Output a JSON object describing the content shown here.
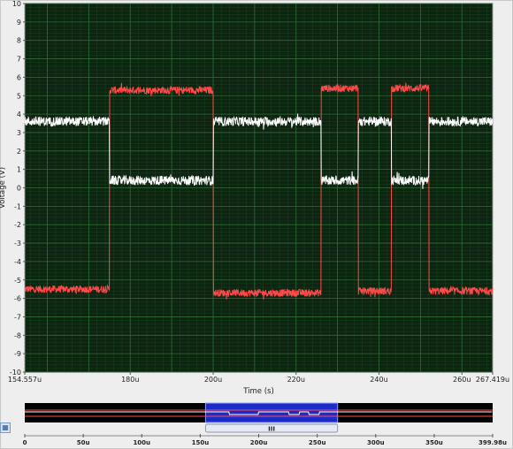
{
  "chart_data": {
    "type": "line",
    "title": "",
    "ylabel": "Voltage (V)",
    "xlabel": "Time (s)",
    "ylim": [
      -10,
      10
    ],
    "xlim": [
      154.557,
      267.419
    ],
    "x_unit": "u",
    "y_ticks": [
      10,
      9,
      8,
      7,
      6,
      5,
      4,
      3,
      2,
      1,
      0,
      -1,
      -2,
      -3,
      -4,
      -5,
      -6,
      -7,
      -8,
      -9,
      -10
    ],
    "x_tick_labels": [
      "154.557u",
      "180u",
      "200u",
      "220u",
      "240u",
      "260u",
      "267.419u"
    ],
    "x_tick_values": [
      154.557,
      180,
      200,
      220,
      240,
      260,
      267.419
    ],
    "grid": true,
    "background": "#0c2410",
    "grid_major_color": "#2f6b38",
    "grid_minor_color": "#1a4220",
    "series": [
      {
        "color": "#ff4a4a",
        "noise": 0.2,
        "steps": [
          [
            154.557,
            -5.5
          ],
          [
            175.0,
            5.3
          ],
          [
            200.0,
            -5.7
          ],
          [
            226.0,
            5.4
          ],
          [
            235.0,
            -5.6
          ],
          [
            243.0,
            5.4
          ],
          [
            252.0,
            -5.6
          ]
        ]
      },
      {
        "color": "#ffffff",
        "noise": 0.25,
        "steps": [
          [
            154.557,
            3.6
          ],
          [
            175.0,
            0.4
          ],
          [
            200.0,
            3.6
          ],
          [
            226.0,
            0.4
          ],
          [
            235.0,
            3.6
          ],
          [
            243.0,
            0.4
          ],
          [
            252.0,
            3.6
          ]
        ]
      }
    ]
  },
  "overview": {
    "tick_labels": [
      "0",
      "50u",
      "100u",
      "150u",
      "200u",
      "250u",
      "300u",
      "350u",
      "399.98u"
    ],
    "tick_values": [
      0,
      50,
      100,
      150,
      200,
      250,
      300,
      350,
      399.98
    ],
    "xlim": [
      0,
      399.98
    ],
    "window_start": 154.557,
    "window_end": 267.419,
    "window_color": "#1c2cc8",
    "background": "#000000",
    "scroll_thumb_label": "III"
  },
  "icons": {
    "left_scroll": "resize-icon"
  }
}
